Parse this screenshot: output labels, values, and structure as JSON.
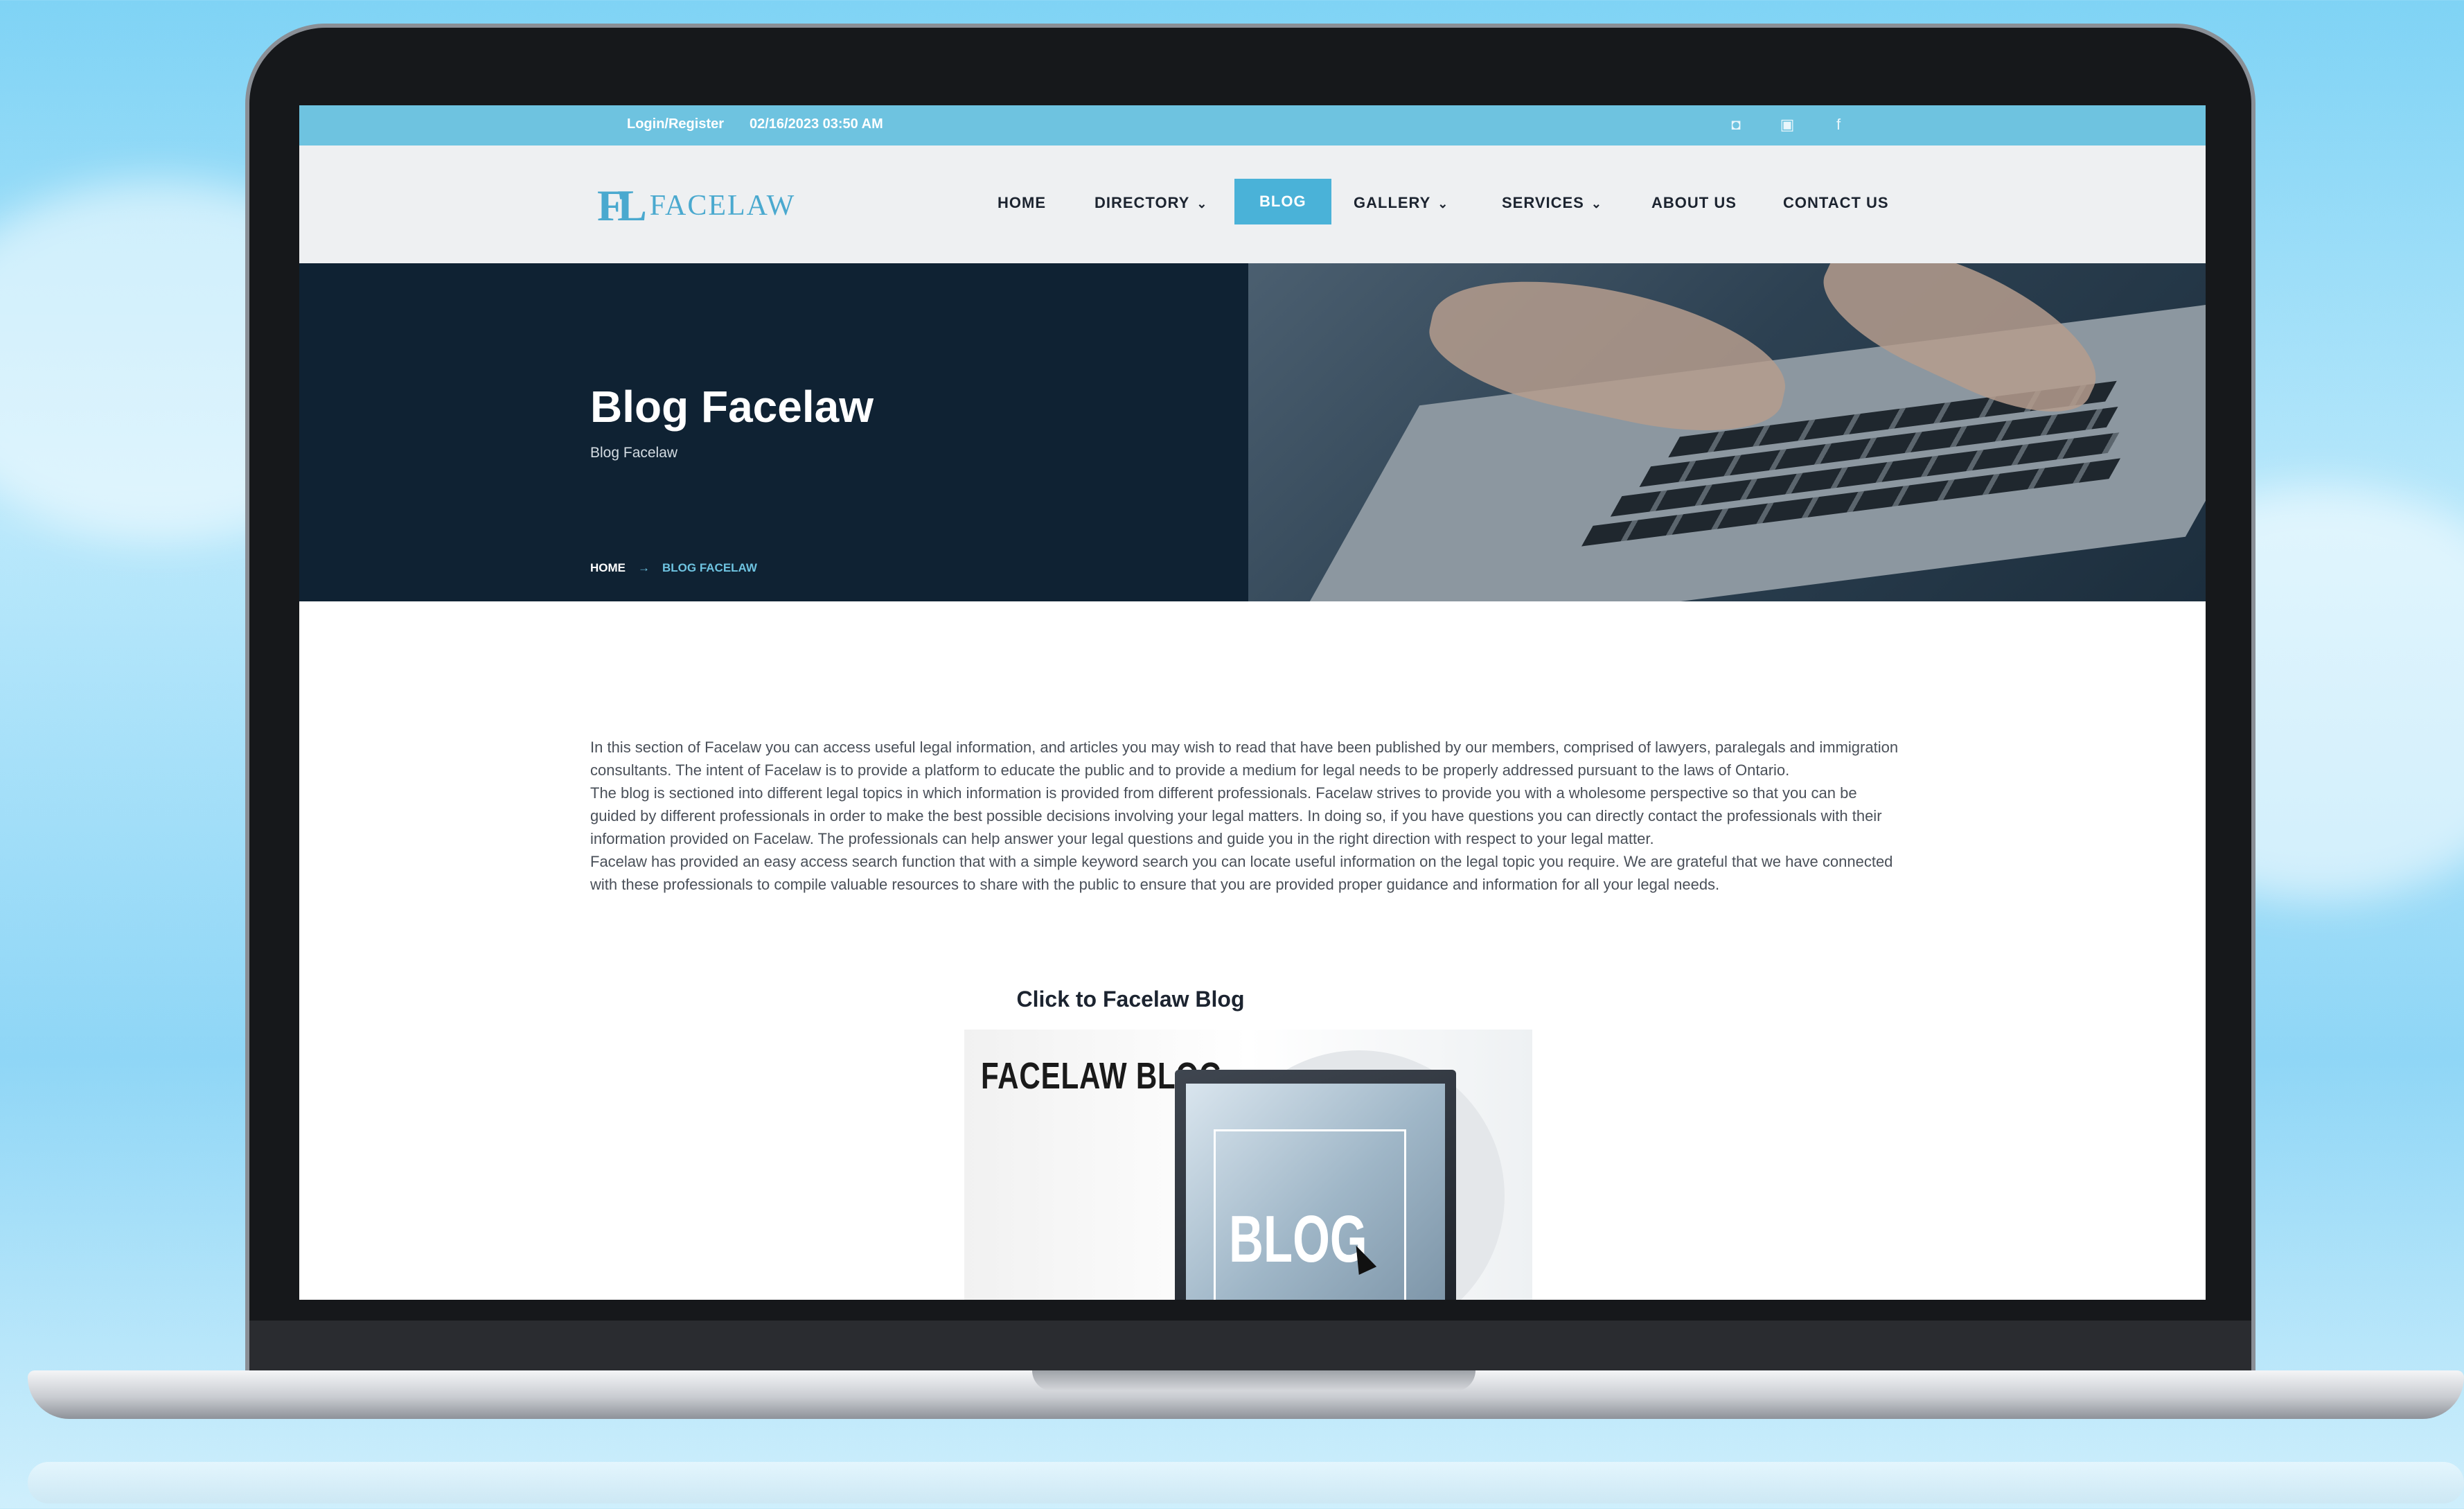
{
  "topbar": {
    "login_label": "Login/Register",
    "datetime": "02/16/2023 03:50 AM",
    "socials": [
      "instagram-icon",
      "youtube-icon",
      "facebook-icon"
    ]
  },
  "brand": {
    "mark": "FL",
    "name": "FACELAW"
  },
  "nav": {
    "home": "HOME",
    "directory": "DIRECTORY",
    "blog": "BLOG",
    "gallery": "GALLERY",
    "services": "SERVICES",
    "about": "ABOUT US",
    "contact": "CONTACT US",
    "active": "BLOG"
  },
  "hero": {
    "title": "Blog Facelaw",
    "subtitle": "Blog Facelaw",
    "breadcrumb": {
      "home": "HOME",
      "current": "BLOG FACELAW"
    }
  },
  "content": {
    "paragraph_1": "In this section of Facelaw you can access useful legal information, and articles you may wish to read that have been published by our members, comprised of lawyers, paralegals and immigration consultants. The intent of Facelaw is to provide a platform to educate the public and to provide a medium for legal needs to be properly addressed pursuant to the laws of Ontario.",
    "paragraph_2": "The blog is sectioned into different legal topics in which information is provided from different professionals. Facelaw strives to provide you with a wholesome perspective so that you can be guided by different professionals in order to make the best possible decisions involving your legal matters. In doing so, if you have questions you can directly contact the professionals with their information provided on Facelaw. The professionals can help answer your legal questions and guide you in the right direction with respect to your legal matter.",
    "paragraph_3": "Facelaw has provided an easy access search function that with a simple keyword search you can locate useful information on the legal topic you require. We are grateful that we have connected with these professionals to compile valuable resources to share with the public to ensure that you are provided proper guidance and information for all your legal needs.",
    "cta": "Click to Facelaw Blog",
    "card_title": "FACELAW BLOG",
    "card_screen_text": "BLOG"
  },
  "colors": {
    "accent": "#4ab2d8",
    "topbar": "#6ec3e0",
    "hero_bg": "#0f2233"
  }
}
